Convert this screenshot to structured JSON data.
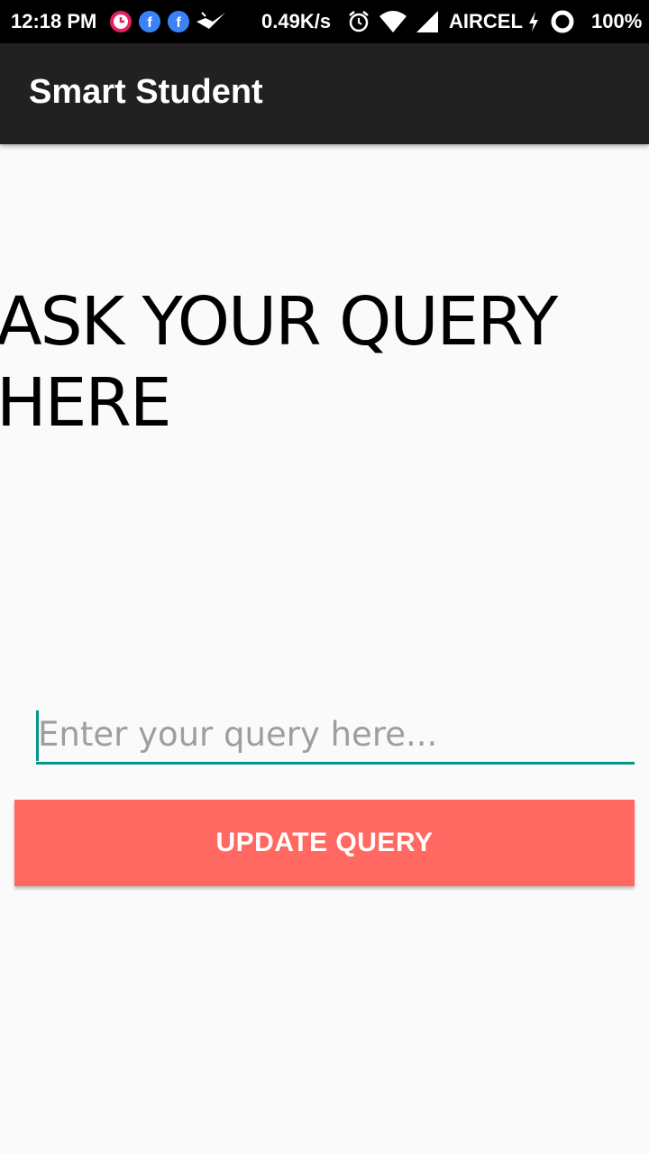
{
  "status_bar": {
    "time": "12:18 PM",
    "network_speed": "0.49K/s",
    "carrier": "AIRCEL",
    "battery": "100%",
    "icons": [
      "clock-app-icon",
      "facebook-icon",
      "facebook-icon",
      "flight-icon",
      "alarm-icon",
      "wifi-icon",
      "signal-icon",
      "charging-icon",
      "battery-icon"
    ]
  },
  "app_bar": {
    "title": "Smart Student"
  },
  "main": {
    "heading": "ASK YOUR QUERY HERE",
    "query_input": {
      "placeholder": "Enter your query here...",
      "value": ""
    },
    "update_button_label": "UPDATE QUERY"
  },
  "colors": {
    "status_bar": "#000000",
    "app_bar": "#212121",
    "background": "#fafafa",
    "accent": "#009688",
    "button": "#ff6961",
    "button_text": "#ffffff"
  }
}
